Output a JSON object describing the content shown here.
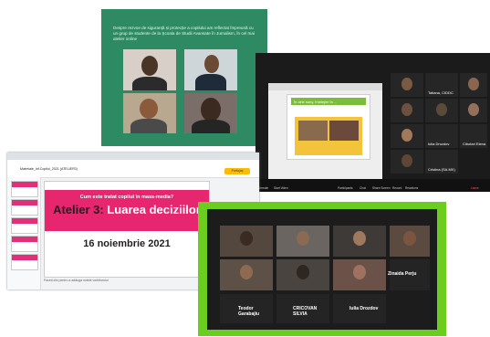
{
  "green_slide": {
    "caption": "Despre rezvoe de siguranță și protecție a copilului am reflectat împreună cu un grup de studente de la Școala de Studii Avansate în Jurnalism, în cel mai atelier online"
  },
  "zoom_top": {
    "participants": [
      {
        "name": "Tatiana, CIDDC"
      },
      {
        "name": "Iulia Drozdov"
      },
      {
        "name": "Cibotari Elena"
      },
      {
        "name": "Cristina (SA.MX)"
      }
    ],
    "slide_title": "În cine suny, înțelejeri în ...",
    "toolbar": [
      "Unmute",
      "Start Video",
      "Participants",
      "Chat",
      "Share Screen",
      "Record",
      "Reactions",
      "Leave"
    ]
  },
  "google_slides": {
    "doc_title": "Materiale_Inf.Copilul_2021 (ATELIER3)",
    "share_label": "Partajați",
    "slide": {
      "question": "Cum este tratat copilul în mass-media?",
      "title_part1": "Atelier 3: ",
      "title_part2": "Luarea deciziilor",
      "date": "16 noiembrie 2021"
    },
    "notes_placeholder": "Faceți clic pentru a adăuga notele vorbitorului"
  },
  "zoom_bottom": {
    "name_labels": [
      "Zinaida Perju",
      "Teodor Garabajiu",
      "CRICOVAN SILVIA",
      "Iulia Drozdov"
    ]
  },
  "colors": {
    "slide_green": "#2e8a63",
    "slide_pink": "#e6266e",
    "zoom_border_green": "#6ccd1f"
  }
}
